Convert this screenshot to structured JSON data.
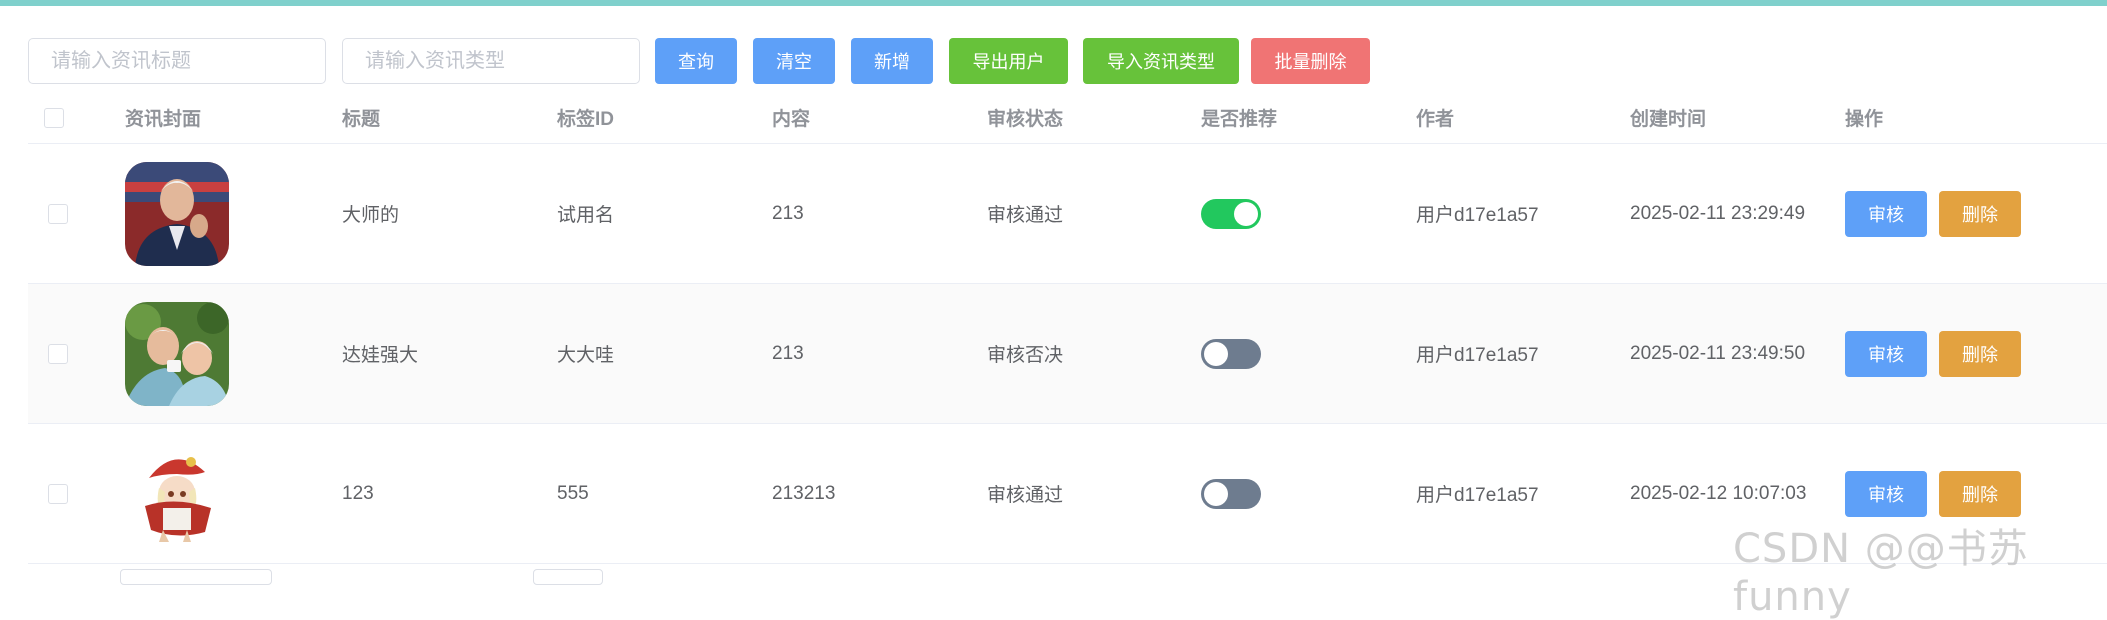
{
  "toolbar": {
    "title_placeholder": "请输入资讯标题",
    "type_placeholder": "请输入资讯类型",
    "query_label": "查询",
    "clear_label": "清空",
    "add_label": "新增",
    "export_label": "导出用户",
    "import_label": "导入资讯类型",
    "batch_delete_label": "批量删除"
  },
  "table": {
    "columns": [
      "资讯封面",
      "标题",
      "标签ID",
      "内容",
      "审核状态",
      "是否推荐",
      "作者",
      "创建时间",
      "操作"
    ],
    "rows": [
      {
        "title": "大师的",
        "tag_id": "试用名",
        "content": "213",
        "status": "审核通过",
        "recommended": true,
        "author": "用户d17e1a57",
        "created": "2025-02-11 23:29:49",
        "cover": "man-photo"
      },
      {
        "title": "达娃强大",
        "tag_id": "大大哇",
        "content": "213",
        "status": "审核否决",
        "recommended": false,
        "author": "用户d17e1a57",
        "created": "2025-02-11 23:49:50",
        "cover": "couple-photo"
      },
      {
        "title": "123",
        "tag_id": "555",
        "content": "213213",
        "status": "审核通过",
        "recommended": false,
        "author": "用户d17e1a57",
        "created": "2025-02-12 10:07:03",
        "cover": "anime-girl-illustration"
      }
    ],
    "review_label": "审核",
    "delete_label": "删除"
  },
  "watermark": "CSDN @@书苏funny",
  "colors": {
    "accent_bar": "#7fd0cc",
    "primary": "#5ea0f8",
    "success": "#67c23a",
    "danger": "#f07474",
    "warning": "#e3a240",
    "switch_on": "#22c85e",
    "switch_off": "#6e7c8f"
  }
}
